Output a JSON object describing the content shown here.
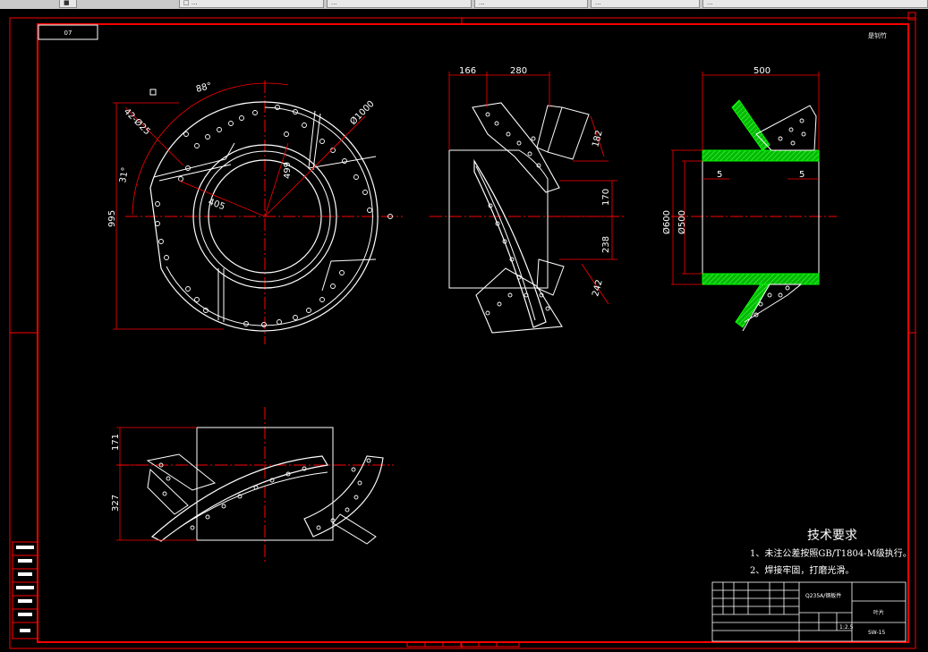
{
  "window": {
    "tabs": [
      {
        "label": "■"
      },
      {
        "label": "□ ..."
      },
      {
        "label": "..."
      },
      {
        "label": "..."
      },
      {
        "label": "..."
      },
      {
        "label": "..."
      }
    ]
  },
  "drawing": {
    "corner_code": "07",
    "signature": "是钊竹",
    "front_view": {
      "dims": {
        "angle_88": "88°",
        "angle_31": "31°",
        "holes": "42-Ø25",
        "dia_1000": "Ø1000",
        "r_499": "499",
        "r_405": "405",
        "h_995": "995"
      }
    },
    "side_view": {
      "dims": {
        "w_166": "166",
        "w_280": "280",
        "d_182": "182",
        "d_170": "170",
        "d_238": "238",
        "d_242": "242"
      }
    },
    "section_view": {
      "dims": {
        "w_500": "500",
        "t_left": "5",
        "t_right": "5",
        "dia_600": "Ø600",
        "dia_500": "Ø500"
      }
    },
    "top_view": {
      "dims": {
        "h_171": "171",
        "h_327": "327"
      }
    },
    "tech_requirements": {
      "title": "技术要求",
      "items": [
        "1、未注公差按照GB/T1804-M级执行。",
        "2、焊接牢固，打磨光滑。"
      ]
    },
    "title_block": {
      "material": "Q235A/钢板件",
      "part_name": "叶片",
      "drawing_no": "SW-15",
      "scale": "1:2.5"
    },
    "colors": {
      "border": "#ff0000",
      "lines": "#ffffff",
      "section_fill": "#00cc00",
      "center_lines": "#ff0000"
    }
  }
}
